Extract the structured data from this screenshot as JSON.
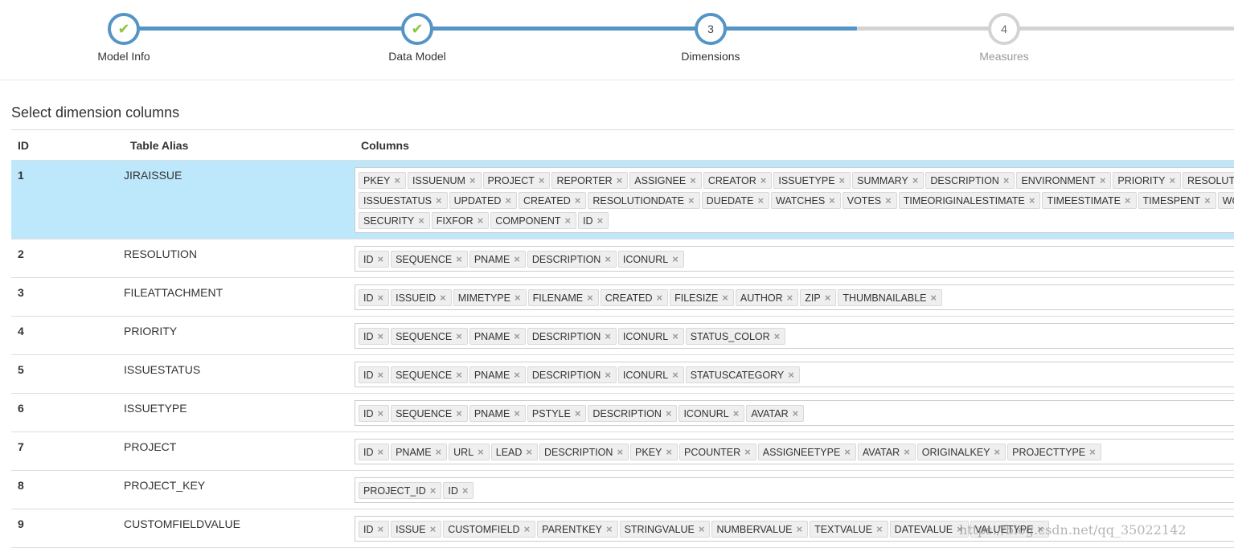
{
  "colors": {
    "accent": "#5495c6",
    "check": "#8cc63f",
    "inactive": "#d3d3d3",
    "selected_row": "#bde8fb",
    "tag_bg": "#efefef"
  },
  "wizard": {
    "steps": [
      {
        "label": "Model Info",
        "state": "done",
        "number": ""
      },
      {
        "label": "Data Model",
        "state": "done",
        "number": ""
      },
      {
        "label": "Dimensions",
        "state": "active",
        "number": "3"
      },
      {
        "label": "Measures",
        "state": "todo",
        "number": "4"
      }
    ]
  },
  "section": {
    "title": "Select dimension columns",
    "headers": {
      "id": "ID",
      "alias": "Table Alias",
      "columns": "Columns"
    }
  },
  "rows": [
    {
      "id": "1",
      "alias": "JIRAISSUE",
      "selected": true,
      "lines": [
        [
          "PKEY",
          "ISSUENUM",
          "PROJECT",
          "REPORTER",
          "ASSIGNEE",
          "CREATOR",
          "ISSUETYPE",
          "SUMMARY",
          "DESCRIPTION",
          "ENVIRONMENT",
          "PRIORITY",
          "RESOLUTION"
        ],
        [
          "ISSUESTATUS",
          "UPDATED",
          "CREATED",
          "RESOLUTIONDATE",
          "DUEDATE",
          "WATCHES",
          "VOTES",
          "TIMEORIGINALESTIMATE",
          "TIMEESTIMATE",
          "TIMESPENT",
          "WORKFLOW_ID"
        ],
        [
          "SECURITY",
          "FIXFOR",
          "COMPONENT",
          "ID"
        ]
      ]
    },
    {
      "id": "2",
      "alias": "RESOLUTION",
      "lines": [
        [
          "ID",
          "SEQUENCE",
          "PNAME",
          "DESCRIPTION",
          "ICONURL"
        ]
      ]
    },
    {
      "id": "3",
      "alias": "FILEATTACHMENT",
      "lines": [
        [
          "ID",
          "ISSUEID",
          "MIMETYPE",
          "FILENAME",
          "CREATED",
          "FILESIZE",
          "AUTHOR",
          "ZIP",
          "THUMBNAILABLE"
        ]
      ]
    },
    {
      "id": "4",
      "alias": "PRIORITY",
      "lines": [
        [
          "ID",
          "SEQUENCE",
          "PNAME",
          "DESCRIPTION",
          "ICONURL",
          "STATUS_COLOR"
        ]
      ]
    },
    {
      "id": "5",
      "alias": "ISSUESTATUS",
      "lines": [
        [
          "ID",
          "SEQUENCE",
          "PNAME",
          "DESCRIPTION",
          "ICONURL",
          "STATUSCATEGORY"
        ]
      ]
    },
    {
      "id": "6",
      "alias": "ISSUETYPE",
      "lines": [
        [
          "ID",
          "SEQUENCE",
          "PNAME",
          "PSTYLE",
          "DESCRIPTION",
          "ICONURL",
          "AVATAR"
        ]
      ]
    },
    {
      "id": "7",
      "alias": "PROJECT",
      "lines": [
        [
          "ID",
          "PNAME",
          "URL",
          "LEAD",
          "DESCRIPTION",
          "PKEY",
          "PCOUNTER",
          "ASSIGNEETYPE",
          "AVATAR",
          "ORIGINALKEY",
          "PROJECTTYPE"
        ]
      ]
    },
    {
      "id": "8",
      "alias": "PROJECT_KEY",
      "lines": [
        [
          "PROJECT_ID",
          "ID"
        ]
      ]
    },
    {
      "id": "9",
      "alias": "CUSTOMFIELDVALUE",
      "lines": [
        [
          "ID",
          "ISSUE",
          "CUSTOMFIELD",
          "PARENTKEY",
          "STRINGVALUE",
          "NUMBERVALUE",
          "TEXTVALUE",
          "DATEVALUE",
          "VALUETYPE"
        ]
      ]
    }
  ],
  "remove_glyph": "×",
  "check_glyph": "✔",
  "watermark": "https://blog.csdn.net/qq_35022142"
}
